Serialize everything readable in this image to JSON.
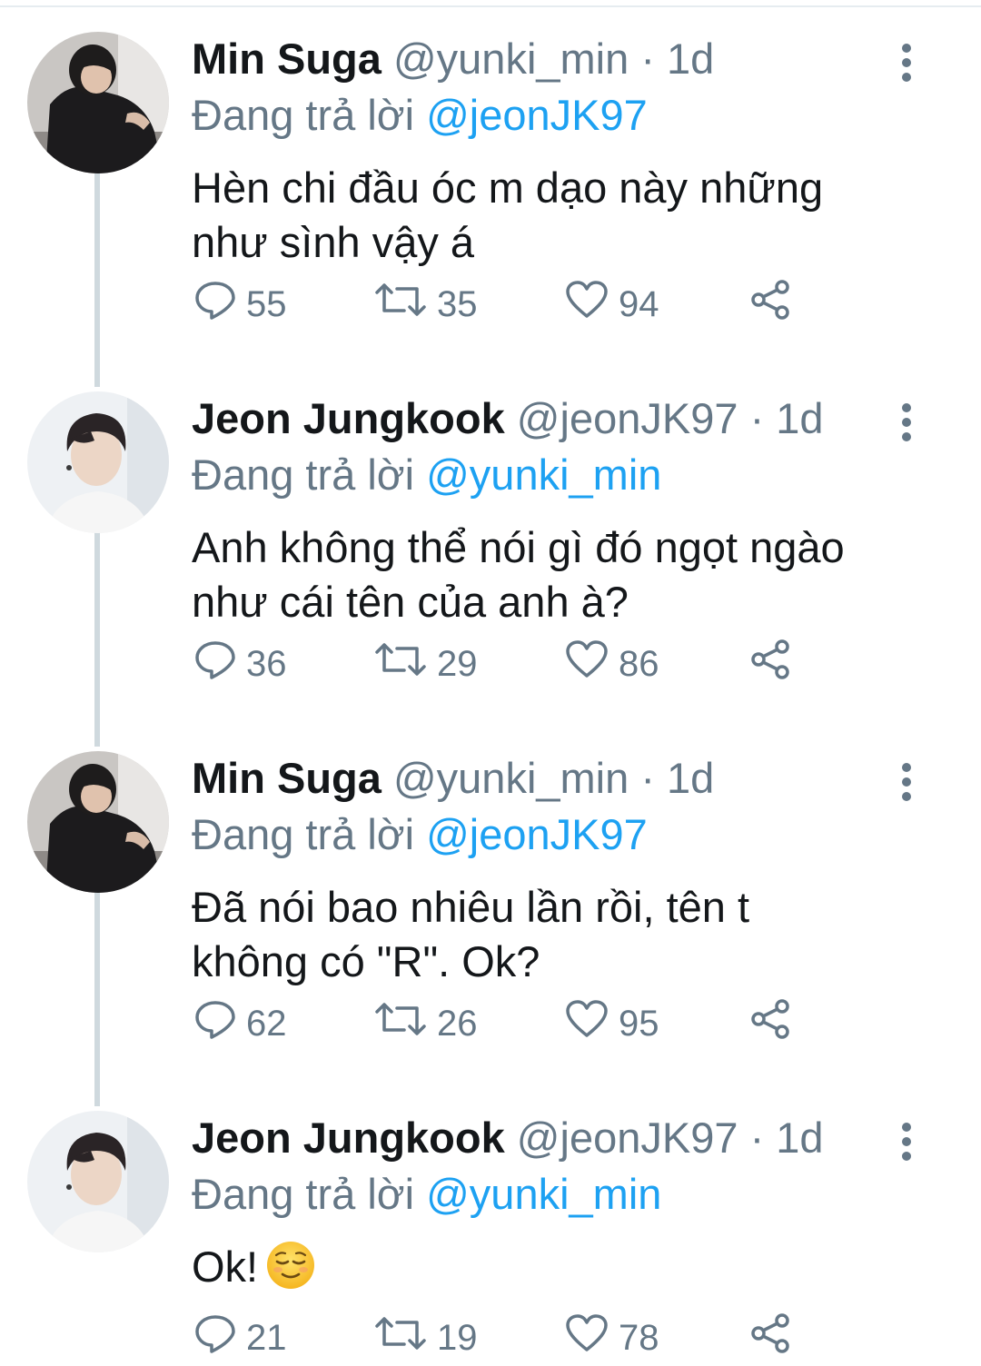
{
  "tweets": [
    {
      "name": "Min Suga",
      "handle": "@yunki_min",
      "separator": "·",
      "time": "1d",
      "reply_prefix": "Đang trả lời",
      "reply_to": "@jeonJK97",
      "text_lines": [
        "Hèn chi đầu óc m dạo này những",
        "như sình vậy á"
      ],
      "replies": "55",
      "retweets": "35",
      "likes": "94"
    },
    {
      "name": "Jeon Jungkook",
      "handle": "@jeonJK97",
      "separator": "·",
      "time": "1d",
      "reply_prefix": "Đang trả lời",
      "reply_to": "@yunki_min",
      "text_lines": [
        "Anh không thể nói gì đó ngọt ngào",
        "như cái tên của anh à?"
      ],
      "replies": "36",
      "retweets": "29",
      "likes": "86"
    },
    {
      "name": "Min Suga",
      "handle": "@yunki_min",
      "separator": "·",
      "time": "1d",
      "reply_prefix": "Đang trả lời",
      "reply_to": "@jeonJK97",
      "text_lines": [
        "Đã nói bao nhiêu lần rồi, tên t",
        "không có \"R\". Ok?"
      ],
      "replies": "62",
      "retweets": "26",
      "likes": "95"
    },
    {
      "name": "Jeon Jungkook",
      "handle": "@jeonJK97",
      "separator": "·",
      "time": "1d",
      "reply_prefix": "Đang trả lời",
      "reply_to": "@yunki_min",
      "text_lines": [
        "Ok!"
      ],
      "emoji": "relieved-face-emoji",
      "replies": "21",
      "retweets": "19",
      "likes": "78"
    }
  ],
  "icons": {
    "reply": "reply-icon",
    "retweet": "retweet-icon",
    "like": "like-icon",
    "share": "share-icon",
    "more": "more-options-icon"
  },
  "colors": {
    "text": "#14171a",
    "secondary": "#657786",
    "mention": "#1da1f2",
    "thread_line": "#cfd9de"
  }
}
